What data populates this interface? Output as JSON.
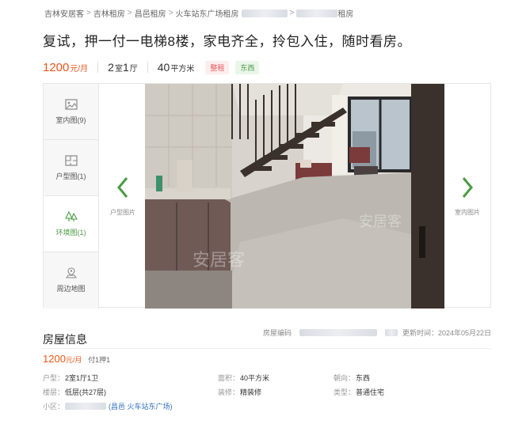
{
  "breadcrumb": {
    "items": [
      "吉林安居客",
      "吉林租房",
      "昌邑租房",
      "火车站东广场租房"
    ],
    "last_suffix": "租房",
    "separator": ">"
  },
  "title": "复试，押一付一电梯8楼，家电齐全，拎包入住，随时看房。",
  "summary": {
    "price": "1200",
    "price_unit": "元/月",
    "rooms_num1": "2",
    "rooms_unit1": "室",
    "rooms_num2": "1",
    "rooms_unit2": "厅",
    "area_num": "40",
    "area_unit": "平方米",
    "tag_rent": "整租",
    "tag_orientation": "东西"
  },
  "gallery": {
    "thumbs": [
      {
        "label": "室内图(9)",
        "icon": "photo-icon"
      },
      {
        "label": "户型图(1)",
        "icon": "floorplan-icon"
      },
      {
        "label": "环境图(1)",
        "icon": "tree-icon"
      },
      {
        "label": "周边地图",
        "icon": "map-pin-icon"
      }
    ],
    "prev_label": "户型图片",
    "next_label": "室内图片",
    "watermark": "安居客"
  },
  "info": {
    "section_title": "房屋信息",
    "code_label": "房屋编码",
    "update_label": "更新时间：2024年05月22日",
    "price": "1200",
    "price_unit": "元/月",
    "pay": "付1押1",
    "rows": {
      "layout_k": "户型：",
      "layout_v": "2室1厅1卫",
      "area_k": "面积：",
      "area_v": "40平方米",
      "orient_k": "朝向：",
      "orient_v": "东西",
      "floor_k": "楼层：",
      "floor_v": "低层(共27层)",
      "deco_k": "装修：",
      "deco_v": "精装修",
      "type_k": "类型：",
      "type_v": "普通住宅",
      "community_k": "小区：",
      "community_link": "(昌邑 火车站东广场)"
    }
  },
  "colors": {
    "accent_orange": "#e8561d",
    "green": "#4a9b44",
    "tag_red": "#e45b5b"
  }
}
